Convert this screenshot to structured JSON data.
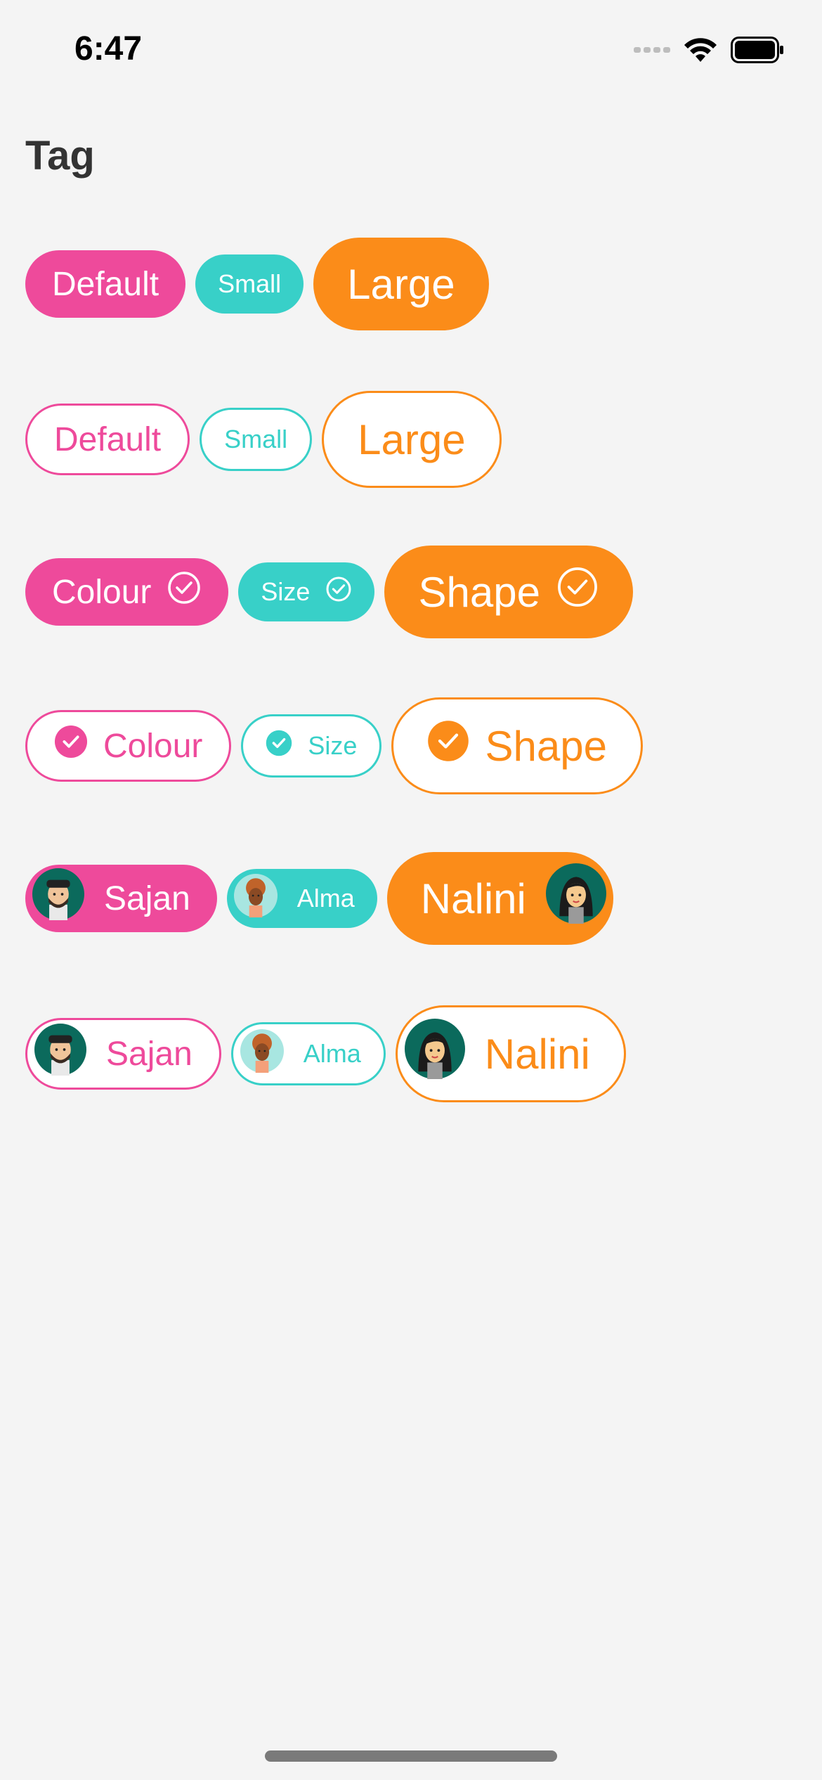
{
  "status": {
    "time": "6:47",
    "icons": [
      "signal-dots-icon",
      "wifi-icon",
      "battery-icon"
    ]
  },
  "page": {
    "title": "Tag"
  },
  "rows": {
    "filled_basic": {
      "default": "Default",
      "small": "Small",
      "large": "Large"
    },
    "outline_basic": {
      "default": "Default",
      "small": "Small",
      "large": "Large"
    },
    "filled_check": {
      "default": "Colour",
      "small": "Size",
      "large": "Shape"
    },
    "outline_check": {
      "default": "Colour",
      "small": "Size",
      "large": "Shape"
    },
    "filled_avatar": {
      "default": "Sajan",
      "small": "Alma",
      "large": "Nalini"
    },
    "outline_avatar": {
      "default": "Sajan",
      "small": "Alma",
      "large": "Nalini"
    }
  },
  "colors": {
    "default": "#ee4a9b",
    "small": "#38d0c8",
    "large": "#fb8c19",
    "background": "#f4f4f4"
  }
}
